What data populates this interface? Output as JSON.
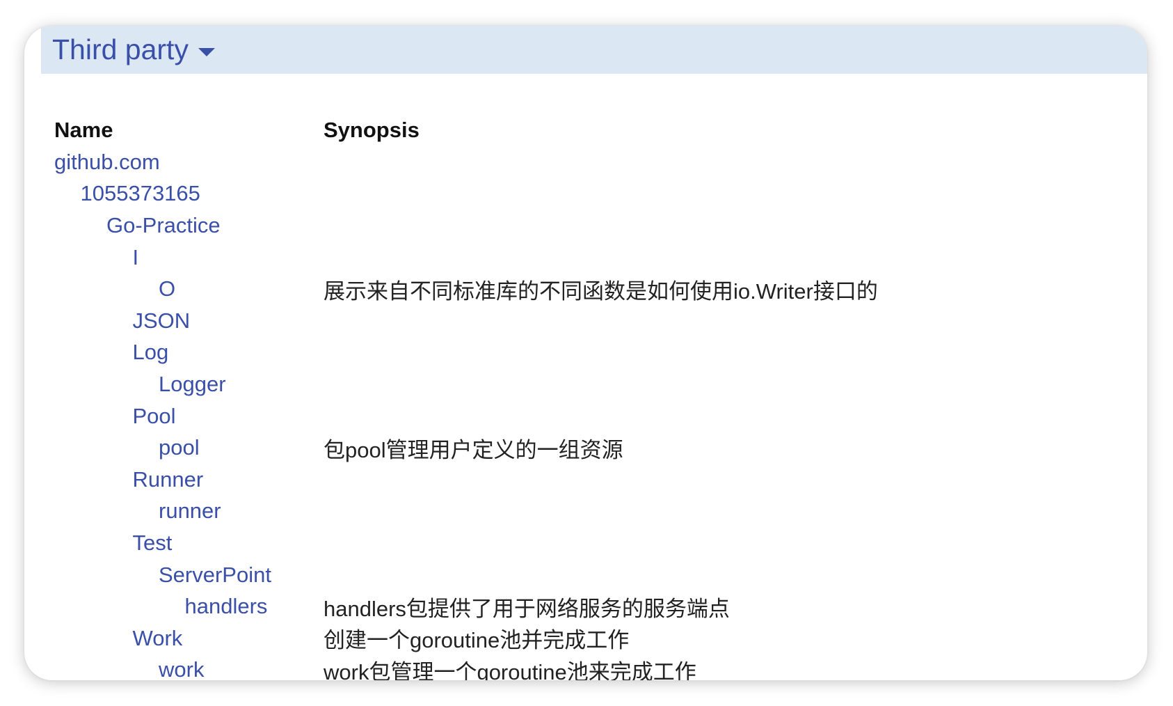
{
  "section": {
    "title": "Third party",
    "dropdown_icon": "caret-down-icon",
    "accent_color": "#3a4fa8",
    "header_bg": "#dce7f4"
  },
  "table": {
    "headers": {
      "name": "Name",
      "synopsis": "Synopsis"
    },
    "rows": [
      {
        "name": "github.com",
        "depth": 0,
        "synopsis": ""
      },
      {
        "name": "1055373165",
        "depth": 1,
        "synopsis": ""
      },
      {
        "name": "Go-Practice",
        "depth": 2,
        "synopsis": ""
      },
      {
        "name": "I",
        "depth": 3,
        "synopsis": ""
      },
      {
        "name": "O",
        "depth": 4,
        "synopsis": "展示来自不同标准库的不同函数是如何使用io.Writer接口的"
      },
      {
        "name": "JSON",
        "depth": 3,
        "synopsis": ""
      },
      {
        "name": "Log",
        "depth": 3,
        "synopsis": ""
      },
      {
        "name": "Logger",
        "depth": 4,
        "synopsis": ""
      },
      {
        "name": "Pool",
        "depth": 3,
        "synopsis": ""
      },
      {
        "name": "pool",
        "depth": 4,
        "synopsis": "包pool管理用户定义的一组资源"
      },
      {
        "name": "Runner",
        "depth": 3,
        "synopsis": ""
      },
      {
        "name": "runner",
        "depth": 4,
        "synopsis": ""
      },
      {
        "name": "Test",
        "depth": 3,
        "synopsis": ""
      },
      {
        "name": "ServerPoint",
        "depth": 4,
        "synopsis": ""
      },
      {
        "name": "handlers",
        "depth": 5,
        "synopsis": "handlers包提供了用于网络服务的服务端点"
      },
      {
        "name": "Work",
        "depth": 3,
        "synopsis": "创建一个goroutine池并完成工作"
      },
      {
        "name": "work",
        "depth": 4,
        "synopsis": "work包管理一个goroutine池来完成工作"
      }
    ]
  }
}
